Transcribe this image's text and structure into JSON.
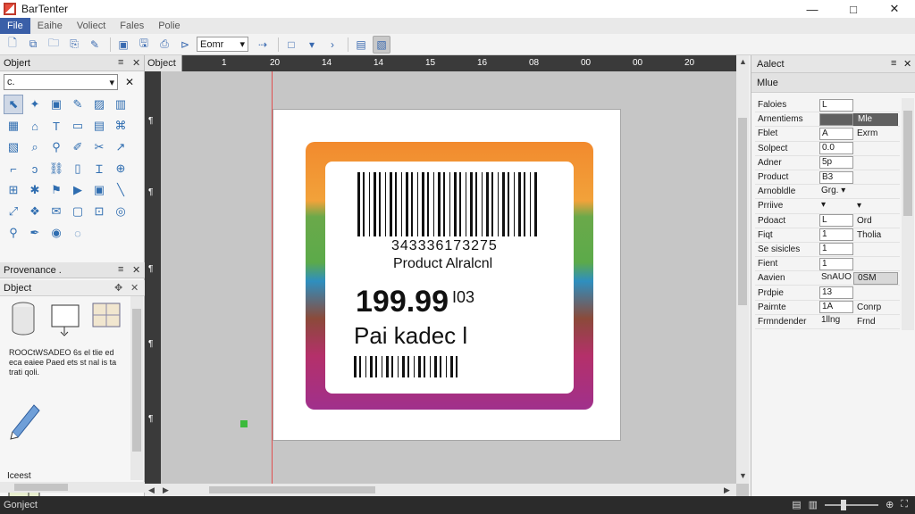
{
  "window": {
    "title": "BarTenter",
    "controls": {
      "minimize": "—",
      "maximize": "□",
      "close": "✕"
    }
  },
  "menu": [
    {
      "label": "File",
      "active": true
    },
    {
      "label": "Eaihe",
      "active": false
    },
    {
      "label": "Voliect",
      "active": false
    },
    {
      "label": "Fales",
      "active": false
    },
    {
      "label": "Polie",
      "active": false
    }
  ],
  "toolbar": {
    "zoom_select": "Eomr"
  },
  "left_pane": {
    "objects_title": "Objert",
    "search_value": "c.",
    "provenance_title": "Provenance .",
    "object_subtitle": "Dbject",
    "description": "ROOCtWSADEO 6s el tlie ed eca eaiee Paed ets st nal is ta trati qoli.",
    "footer": "Iceest"
  },
  "canvas": {
    "tab_label": "Object",
    "ruler_labels": [
      "1",
      "20",
      "14",
      "14",
      "15",
      "16",
      "08",
      "00",
      "00",
      "20"
    ],
    "label": {
      "barcode_number": "343336173275",
      "barcode_caption": "Product Alralcnl",
      "price": "199.99",
      "price_suffix": "I03",
      "product_line": "Pai kadec l"
    }
  },
  "properties": {
    "title": "Aalect",
    "subtitle": "Mlue",
    "rows": [
      {
        "name": "Faloies",
        "value": "L",
        "extra": "",
        "val_style": "",
        "extra_style": ""
      },
      {
        "name": "Arnentiems",
        "value": "",
        "extra": "Mle",
        "val_style": "dark",
        "extra_style": "dark"
      },
      {
        "name": "Fblet",
        "value": "A",
        "extra": "Exrm",
        "val_style": "",
        "extra_style": ""
      },
      {
        "name": "Solpect",
        "value": "0.0",
        "extra": "",
        "val_style": "",
        "extra_style": ""
      },
      {
        "name": "Adner",
        "value": "5p",
        "extra": "",
        "val_style": "",
        "extra_style": ""
      },
      {
        "name": "Product",
        "value": "B3",
        "extra": "",
        "val_style": "",
        "extra_style": ""
      },
      {
        "name": "Arnobldle",
        "value": "Grg. ▾",
        "extra": "",
        "val_style": "plain",
        "extra_style": ""
      },
      {
        "name": "Prriive",
        "value": "▾",
        "extra": "▾",
        "val_style": "plain",
        "extra_style": ""
      },
      {
        "name": "Pdoact",
        "value": "L",
        "extra": "Ord",
        "val_style": "",
        "extra_style": ""
      },
      {
        "name": "Fiqt",
        "value": "1",
        "extra": "Tholia",
        "val_style": "",
        "extra_style": ""
      },
      {
        "name": "Se sisicles",
        "value": "1",
        "extra": "",
        "val_style": "",
        "extra_style": ""
      },
      {
        "name": "Fient",
        "value": "1",
        "extra": "",
        "val_style": "",
        "extra_style": ""
      },
      {
        "name": "Aavien",
        "value": "SnAUO",
        "extra": "0SM",
        "val_style": "plain",
        "extra_style": "boxed"
      },
      {
        "name": "Prdpie",
        "value": "13",
        "extra": "",
        "val_style": "",
        "extra_style": ""
      },
      {
        "name": "Pairnte",
        "value": "1A",
        "extra": "Conrp",
        "val_style": "",
        "extra_style": ""
      },
      {
        "name": "Frmndender",
        "value": "1llng",
        "extra": "Frnd",
        "val_style": "plain",
        "extra_style": ""
      }
    ]
  },
  "status": {
    "text": "Gonject"
  },
  "icons": {
    "tools": [
      "pointer-icon",
      "sparkle-icon",
      "image-icon",
      "edit-icon",
      "picture-icon",
      "chart-icon",
      "grid-icon",
      "lock-icon",
      "text-icon",
      "box-icon",
      "document-icon",
      "tree-icon",
      "layout-icon",
      "search-icon",
      "link-icon",
      "paint-icon",
      "scissors-icon",
      "arrow-icon",
      "corner-icon",
      "ear-icon",
      "chain-icon",
      "barcode-icon",
      "text-cursor-icon",
      "zoom-icon",
      "grid2-icon",
      "star-icon",
      "flag-icon",
      "play-icon",
      "picture2-icon",
      "diagonal-icon",
      "expand-icon",
      "component-icon",
      "envelope-icon",
      "window-icon",
      "frame-icon",
      "compass-icon",
      "magnify-icon",
      "pen-icon",
      "target-icon",
      "radar-icon"
    ]
  },
  "colors": {
    "menu_active": "#3a5fa8",
    "ruler": "#3a3a3a",
    "status_bar": "#2b2b2b",
    "guide": "#e05050"
  }
}
